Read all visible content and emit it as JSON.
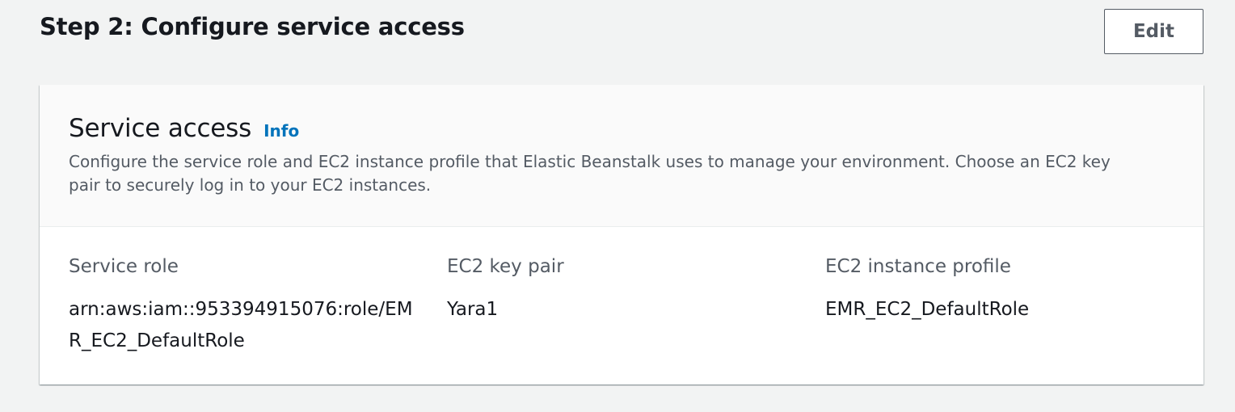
{
  "step": {
    "title": "Step 2: Configure service access",
    "edit_label": "Edit"
  },
  "section": {
    "title": "Service access",
    "info_label": "Info",
    "description": "Configure the service role and EC2 instance profile that Elastic Beanstalk uses to manage your environment. Choose an EC2 key pair to securely log in to your EC2 instances."
  },
  "details": [
    {
      "label": "Service role",
      "value": "arn:aws:iam::953394915076:role/EMR_EC2_DefaultRole"
    },
    {
      "label": "EC2 key pair",
      "value": "Yara1"
    },
    {
      "label": "EC2 instance profile",
      "value": "EMR_EC2_DefaultRole"
    }
  ],
  "colors": {
    "page_background": "#f2f3f3",
    "link": "#0073bb",
    "text_primary": "#16191f",
    "text_secondary": "#545b64"
  }
}
